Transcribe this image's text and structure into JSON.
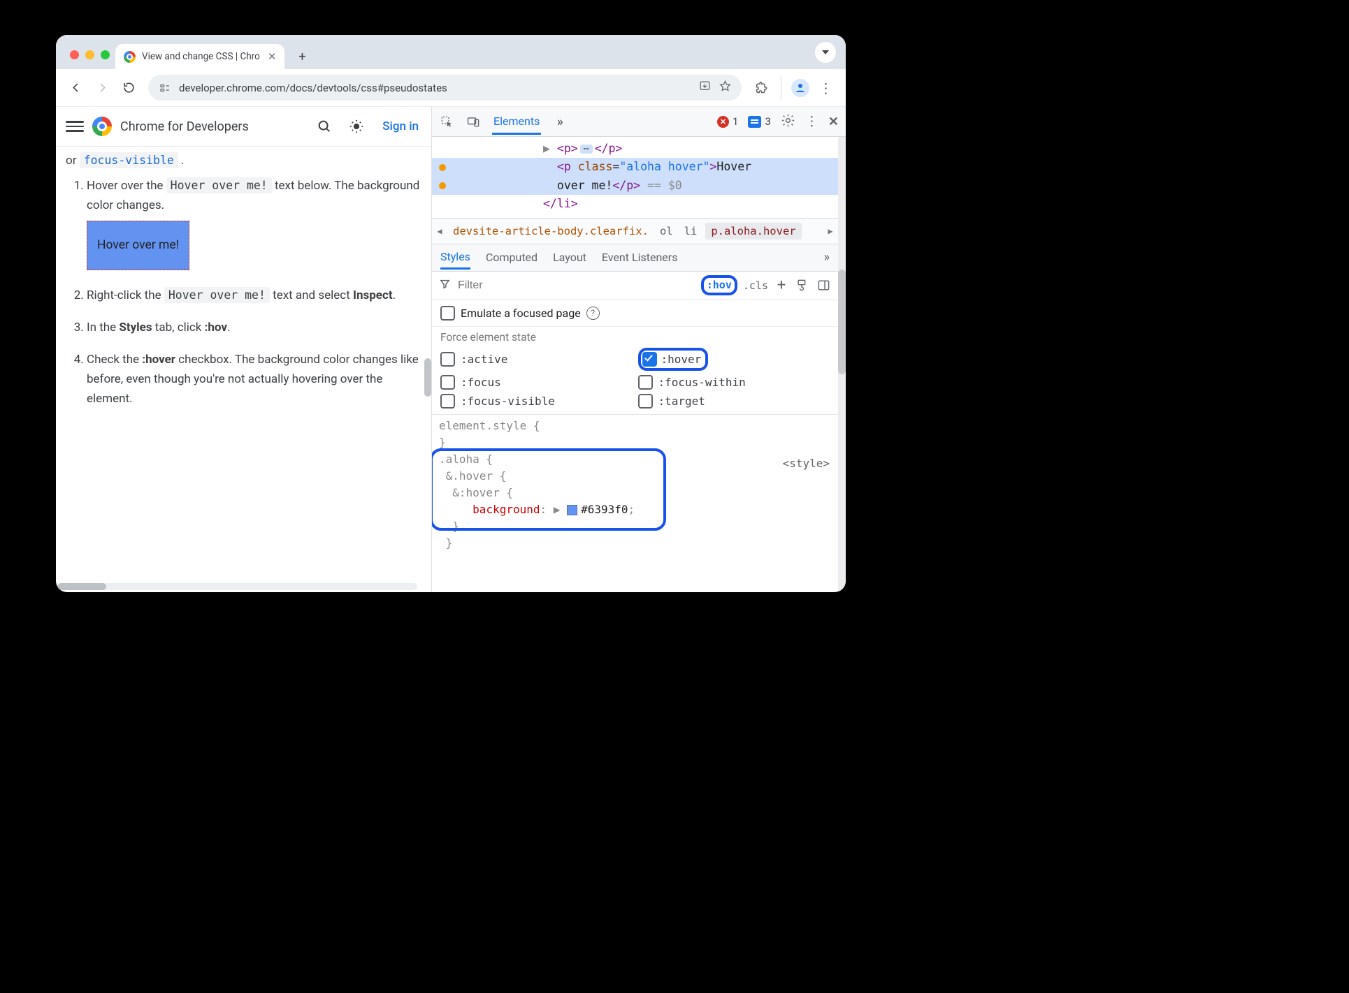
{
  "window": {
    "tab_title": "View and change CSS  |  Chro",
    "url": "developer.chrome.com/docs/devtools/css#pseudostates"
  },
  "page_header": {
    "brand": "Chrome for Developers",
    "sign_in": "Sign in"
  },
  "article": {
    "partial_or": "or",
    "focus_visible": "focus-visible",
    "steps": {
      "s1a": "Hover over the ",
      "s1_code": "Hover over me!",
      "s1b": " text below. The background color changes.",
      "hover_box": "Hover over me!",
      "s2a": "Right-click the ",
      "s2_code": "Hover over me!",
      "s2b": " text and select ",
      "s2_strong": "Inspect",
      "s3a": "In the ",
      "s3_strong": "Styles",
      "s3b": " tab, click ",
      "s3_strong2": ":hov",
      "s4a": "Check the ",
      "s4_strong": ":hover",
      "s4b": " checkbox. The background color changes like before, even though you're not actually hovering over the element."
    }
  },
  "devtools": {
    "tabs": {
      "elements": "Elements"
    },
    "errors": "1",
    "messages": "3",
    "dom": {
      "l1": "▶ <p> ⋯ </p>",
      "l2_text": "Hover over me!",
      "l3": "</li>"
    },
    "crumbs": {
      "c1": "devsite-article-body.clearfix.",
      "c2": "ol",
      "c3": "li",
      "c4": "p.aloha.hover"
    },
    "styles_tabs": {
      "styles": "Styles",
      "computed": "Computed",
      "layout": "Layout",
      "events": "Event Listeners"
    },
    "filter": {
      "placeholder": "Filter",
      "hov": ":hov",
      "cls": ".cls"
    },
    "emulate": "Emulate a focused page",
    "force": {
      "title": "Force element state",
      "active": ":active",
      "hover": ":hover",
      "focus": ":focus",
      "focus_within": ":focus-within",
      "focus_visible": ":focus-visible",
      "target": ":target"
    },
    "css": {
      "elstyle": "element.style {",
      "close": "}",
      "aloha": ".aloha {",
      "amphover": "&.hover {",
      "amppseudo": "&:hover {",
      "bgprop": "background",
      "bgval": "#6393f0",
      "src": "<style>"
    }
  }
}
